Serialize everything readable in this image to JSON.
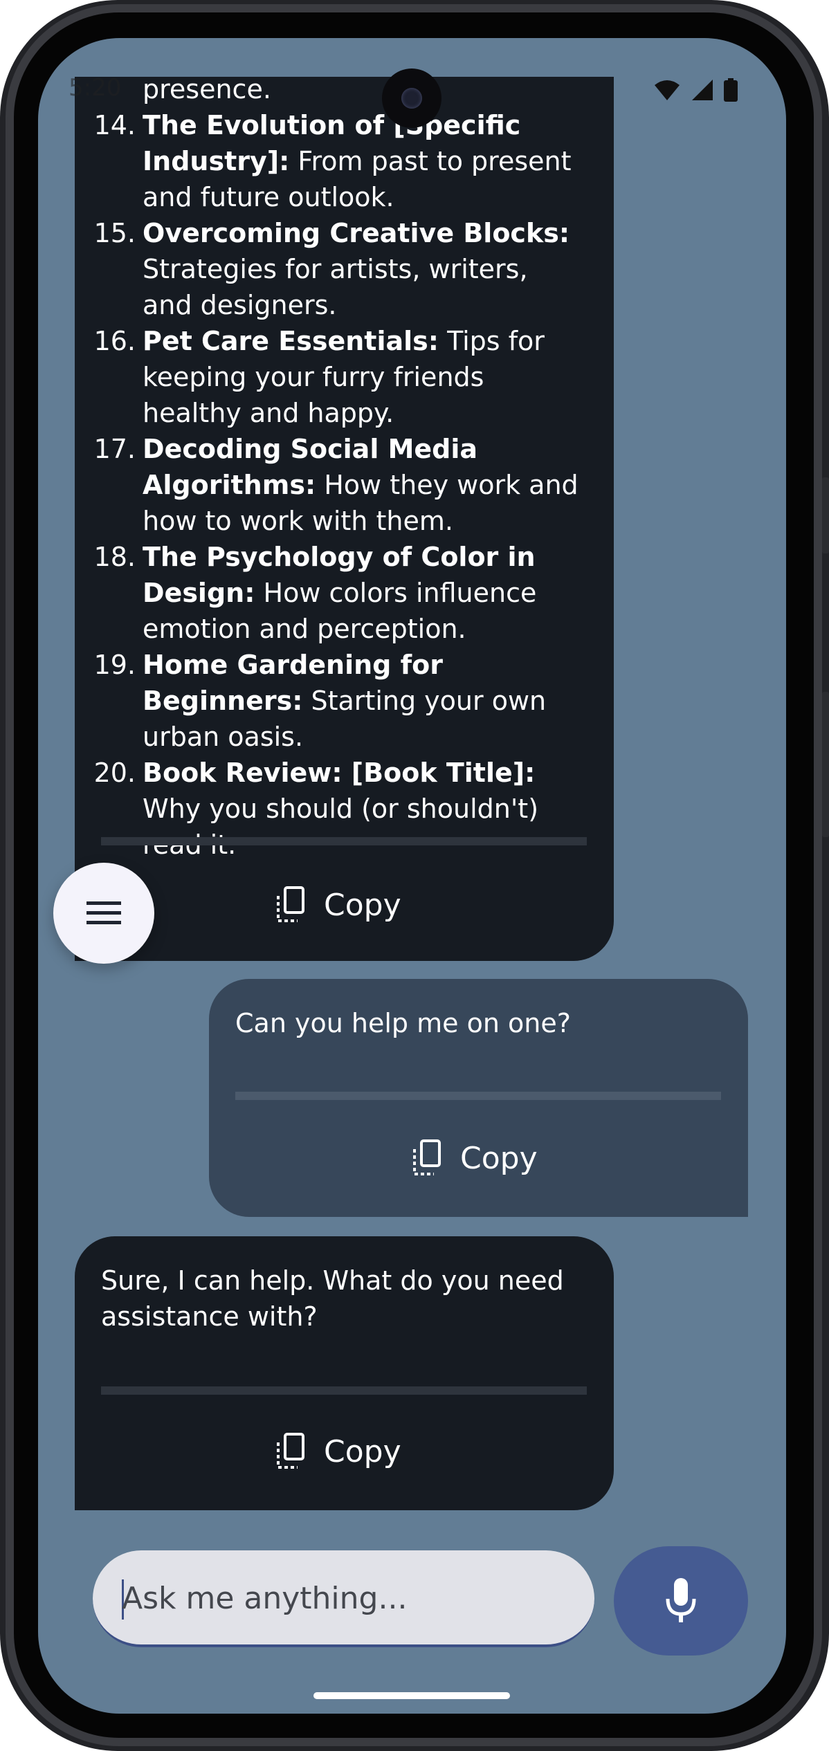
{
  "status_bar": {
    "time": "5:20"
  },
  "chat": {
    "bot_message_1": {
      "partial_top": "presence.",
      "items": [
        {
          "num": "14.",
          "title": "The Evolution of [Specific Industry]:",
          "desc": "From past to present and future outlook."
        },
        {
          "num": "15.",
          "title": "Overcoming Creative Blocks:",
          "desc": "Strategies for artists, writers, and designers."
        },
        {
          "num": "16.",
          "title": "Pet Care Essentials:",
          "desc": "Tips for keeping your furry friends healthy and happy."
        },
        {
          "num": "17.",
          "title": "Decoding Social Media Algorithms:",
          "desc": "How they work and how to work with them."
        },
        {
          "num": "18.",
          "title": "The Psychology of Color in Design:",
          "desc": "How colors influence emotion and perception."
        },
        {
          "num": "19.",
          "title": "Home Gardening for Beginners:",
          "desc": "Starting your own urban oasis."
        },
        {
          "num": "20.",
          "title": "Book Review: [Book Title]:",
          "desc": "Why you should (or shouldn't) read it."
        }
      ],
      "copy_label": "Copy"
    },
    "user_message": {
      "text": "Can you help me on one?",
      "copy_label": "Copy"
    },
    "bot_message_2": {
      "text": "Sure, I can help. What do you need assistance with?",
      "copy_label": "Copy"
    }
  },
  "composer": {
    "placeholder": "Ask me anything..."
  },
  "colors": {
    "background": "#627d95",
    "bot_bubble": "#161b22",
    "user_bubble": "#37475a",
    "mic_button": "#455b92"
  },
  "icons": [
    "menu-icon",
    "copy-icon",
    "mic-icon",
    "wifi-icon",
    "signal-icon",
    "battery-icon"
  ]
}
